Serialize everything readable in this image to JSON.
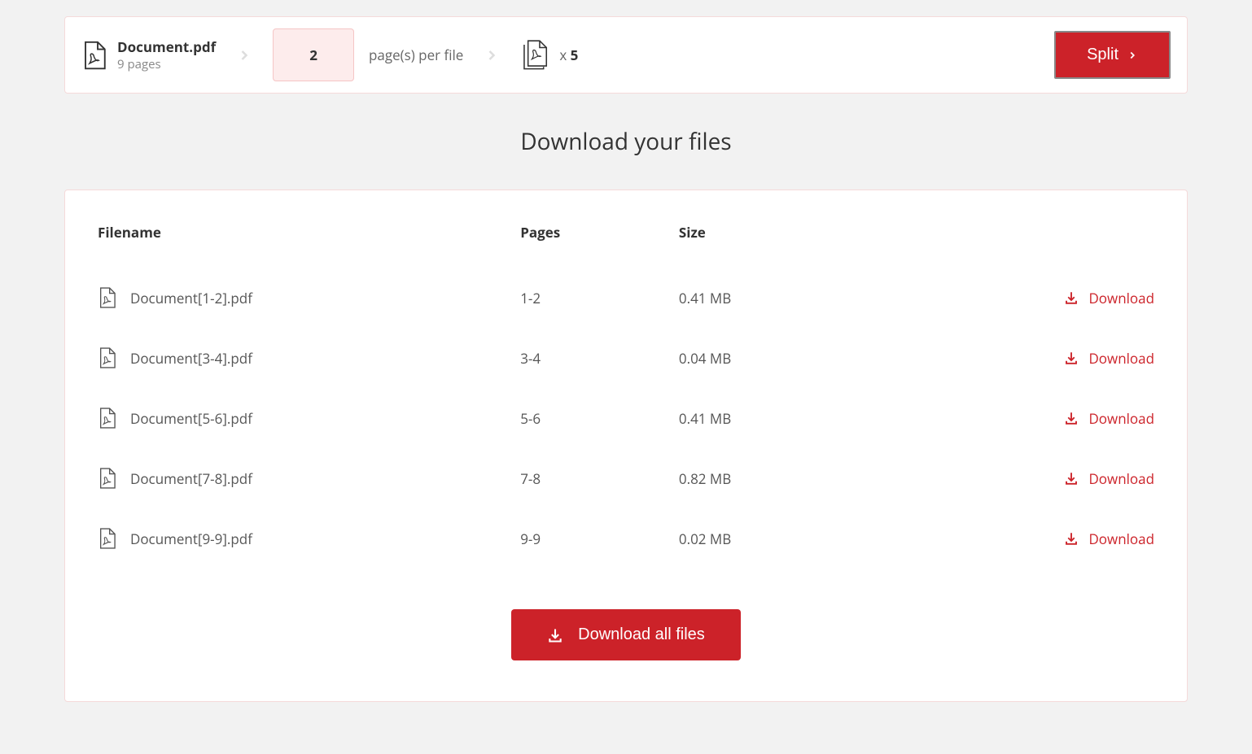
{
  "source": {
    "filename": "Document.pdf",
    "pages_label": "9 pages"
  },
  "split_config": {
    "pages_per_file_value": "2",
    "pages_per_file_label": "page(s) per file",
    "output_prefix": "x ",
    "output_count": "5"
  },
  "actions": {
    "split_label": "Split",
    "download_all_label": "Download all files",
    "row_download_label": "Download"
  },
  "heading": "Download your files",
  "table_headers": {
    "filename": "Filename",
    "pages": "Pages",
    "size": "Size"
  },
  "files": [
    {
      "filename": "Document[1-2].pdf",
      "pages": "1-2",
      "size": "0.41 MB"
    },
    {
      "filename": "Document[3-4].pdf",
      "pages": "3-4",
      "size": "0.04 MB"
    },
    {
      "filename": "Document[5-6].pdf",
      "pages": "5-6",
      "size": "0.41 MB"
    },
    {
      "filename": "Document[7-8].pdf",
      "pages": "7-8",
      "size": "0.82 MB"
    },
    {
      "filename": "Document[9-9].pdf",
      "pages": "9-9",
      "size": "0.02 MB"
    }
  ]
}
